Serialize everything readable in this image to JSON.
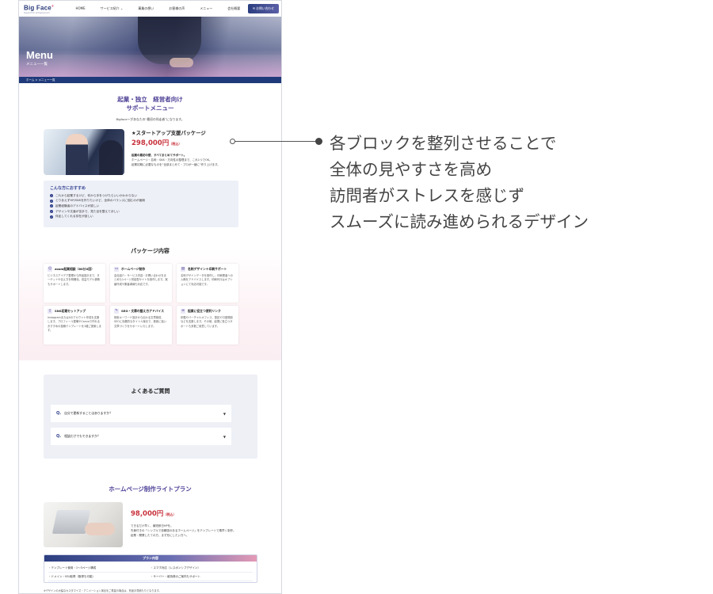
{
  "nav": {
    "logo": "Big Face",
    "logo_mark": "®",
    "logo_sub": "Support for entrepreneurs",
    "items": [
      "HOME",
      "サービス紹介",
      "事業の想い",
      "お客様の声",
      "メニュー",
      "会社概要"
    ],
    "cta": "お問い合わせ"
  },
  "hero": {
    "title": "Menu",
    "subtitle": "メニュー一覧"
  },
  "breadcrumb": "ホーム > メニュー一覧",
  "intro": {
    "heading_line1": "起業・独立　経営者向け",
    "heading_line2": "サポートメニュー",
    "tagline": "Bigfaceーがあなたの“最初の伴走者”になります。"
  },
  "package": {
    "title": "★スタートアップ支援パッケージ",
    "price": "298,000円",
    "tax": "（税込）",
    "desc_bold": "起業の最初の壁、すべてまとめてサポート。",
    "desc_line2": "ホームページ・名刺・SNS・方向性の整理まで、これ1つでOK。",
    "desc_line3": "起業初期に必要なものを“全部まとめて・プロが一緒に”作り上げます。"
  },
  "recommend": {
    "title": "こんな方におすすめ",
    "items": [
      "これから起業するけど、何から手をつけたらいいかわからない",
      "とりあえずHP/SNSを作りたいけど、全体のバランスに悩むのが面倒",
      "起業経験者のアドバイスが欲しい",
      "デザインや文章が苦手で、見た目を整えてほしい",
      "伴走してくれる存在が欲しい"
    ]
  },
  "contents": {
    "title": "パッケージ内容",
    "cards": [
      {
        "icon": "user",
        "title": "zoom起業相談（60分X回）",
        "body": "ビジネスアイデア整理から商品設計まで、ターゲットや伝え方を明確化。収益モデル構築もサポートします。"
      },
      {
        "icon": "monitor",
        "title": "ホームページ制作",
        "body": "会社紹介・サービス内容・お問い合わせをまとめた1ページ完結型サイトを制作します。実績作成や集客導線も対応です。"
      },
      {
        "icon": "card",
        "title": "名刺デザイン＋印刷サポート",
        "body": "名刺デザインデータを制作し、印刷業者への入稿をアドバイスします。印刷代行はオプションにて対応可能です。"
      },
      {
        "icon": "sns",
        "title": "SNS初期セットアップ",
        "body": "InstagramまたはXのアカウント作成を支援します。プロフィール整備やCanvaで作れるおすすめの投稿テンプレートを1種ご提案します。"
      },
      {
        "icon": "pen",
        "title": "SEO・文章の整え方アドバイス",
        "body": "検索キーワード設計から伝わる文章構成、SEOに効果的なタイトル案まで、検索に強い文章づくりをサポートいたします。"
      },
      {
        "icon": "link",
        "title": "起業に役立つ便利リンク",
        "body": "印鑑やバーチャルオフィス、登記や口座開設などを支援します。その他、起業に役立つサポートも多数ご用意しています。"
      }
    ]
  },
  "faq": {
    "title": "よくあるご質問",
    "q_label": "Q.",
    "items": [
      "自分で更新することはありますか？",
      "相談だけでもできますか？"
    ]
  },
  "homepage_plan": {
    "title": "ホームページ制作ライトプラン",
    "price": "98,000円",
    "tax": "（税込）",
    "desc_line1": "できるだけ早く、最短即日HPを。",
    "desc_line2": "先輩付きの「シンプルで信頼感のあるホームページ」をテンプレートで素早く制作。",
    "desc_line3": "起業・開業したての方、まず形にしたい方へ。",
    "plan_head": "プラン内容",
    "plan_items": [
      "・テンプレート使用・1〜3ページ構成",
      "・スマホ対応（レスポンシブデザイン）",
      "・ドメイン・SSL取得（取得も可能）",
      "・サーバー・維持費のご案内もサポート"
    ],
    "note": "※デザインの大幅なカスタマイズ・アニメーション演出をご希望の場合は、別途お見積もりとなります。"
  },
  "annotation": {
    "lines": [
      "各ブロックを整列させることで",
      "全体の見やすさを高め",
      "訪問者がストレスを感じず",
      "スムーズに読み進められるデザイン"
    ]
  },
  "colors": {
    "navy": "#1f3a7a",
    "purple": "#4d4196",
    "price_red": "#c8323c",
    "pink": "#e49ab5"
  }
}
